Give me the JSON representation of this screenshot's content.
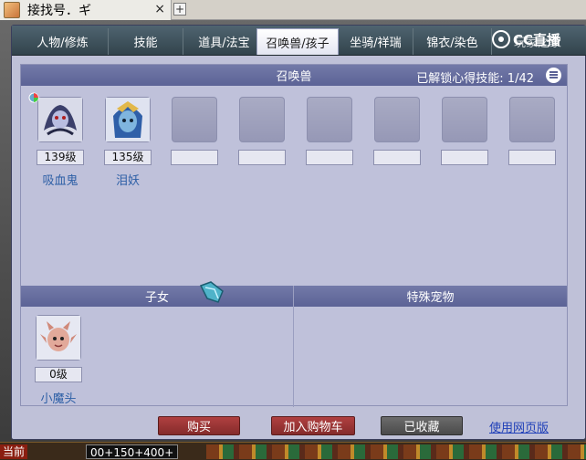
{
  "browser_tab": {
    "title": "接找号．ギ",
    "close": "×",
    "plus": "+"
  },
  "nav": {
    "tabs": [
      {
        "label": "人物/修炼"
      },
      {
        "label": "技能"
      },
      {
        "label": "道具/法宝"
      },
      {
        "label": "召唤兽/孩子"
      },
      {
        "label": "坐骑/祥瑞"
      },
      {
        "label": "锦衣/染色"
      },
      {
        "label": "玩家之家"
      }
    ],
    "active_index": 3,
    "logo_text": "CC直播"
  },
  "summon": {
    "title": "召唤兽",
    "unlock_label": "已解锁心得技能:",
    "unlock_value": "1/42",
    "pets": [
      {
        "level": "139级",
        "name": "吸血鬼"
      },
      {
        "level": "135级",
        "name": "泪妖"
      }
    ],
    "empty_slots": 6
  },
  "children": {
    "title": "子女",
    "items": [
      {
        "level": "0级",
        "name": "小魔头"
      }
    ]
  },
  "special_pets": {
    "title": "特殊宠物"
  },
  "actions": {
    "buy": "购买",
    "add_cart": "加入购物车",
    "favorited": "已收藏",
    "web_version": "使用网页版"
  },
  "taskbar": {
    "current": "当前",
    "coords": "00+150+400+"
  },
  "colors": {
    "section_bar": "#5c6396",
    "panel_bg": "#bfc1da",
    "buy_red": "#852b2b",
    "link_blue": "#1f3fb8"
  }
}
